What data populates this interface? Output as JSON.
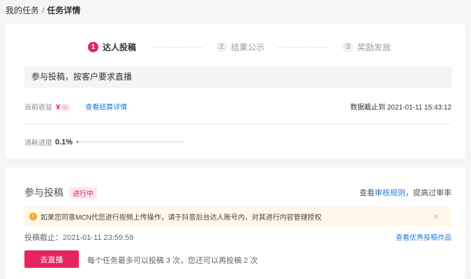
{
  "breadcrumb": {
    "parent": "我的任务",
    "separator": "/",
    "current": "任务详情"
  },
  "steps": [
    {
      "num": "1",
      "label": "达人投稿"
    },
    {
      "num": "2",
      "label": "结果公示"
    },
    {
      "num": "3",
      "label": "奖励发放"
    }
  ],
  "task": {
    "description": "参与投稿，按客户要求直播"
  },
  "income": {
    "label": "当前收益",
    "currency": "¥",
    "detail_link": "查看结算详情",
    "data_deadline": "数据截止到 2021-01-11 15:43:12"
  },
  "progress": {
    "label": "消耗进度",
    "value": "0.1%",
    "fraction": 0.001
  },
  "submission": {
    "title": "参与投稿",
    "status": "进行中",
    "rule_prefix": "查看",
    "rule_link": "审核规则",
    "rule_suffix": "，提高过审率",
    "notice_icon": "!",
    "notice": "如果您同意MCN代您进行视频上传操作，请于抖音后台达人账号内，对其进行内容管理授权",
    "close": "×",
    "deadline": "投稿截止：2021-01-11 23:59:59",
    "examples_link": "查看优秀投稿作品",
    "go_button": "去直播",
    "limit_text": "每个任务最多可以投稿 3 次，您还可以再投稿 2 次"
  },
  "colors": {
    "accent": "#e5245d",
    "link": "#1f7ad6",
    "notice_bg": "#fff7e9"
  }
}
